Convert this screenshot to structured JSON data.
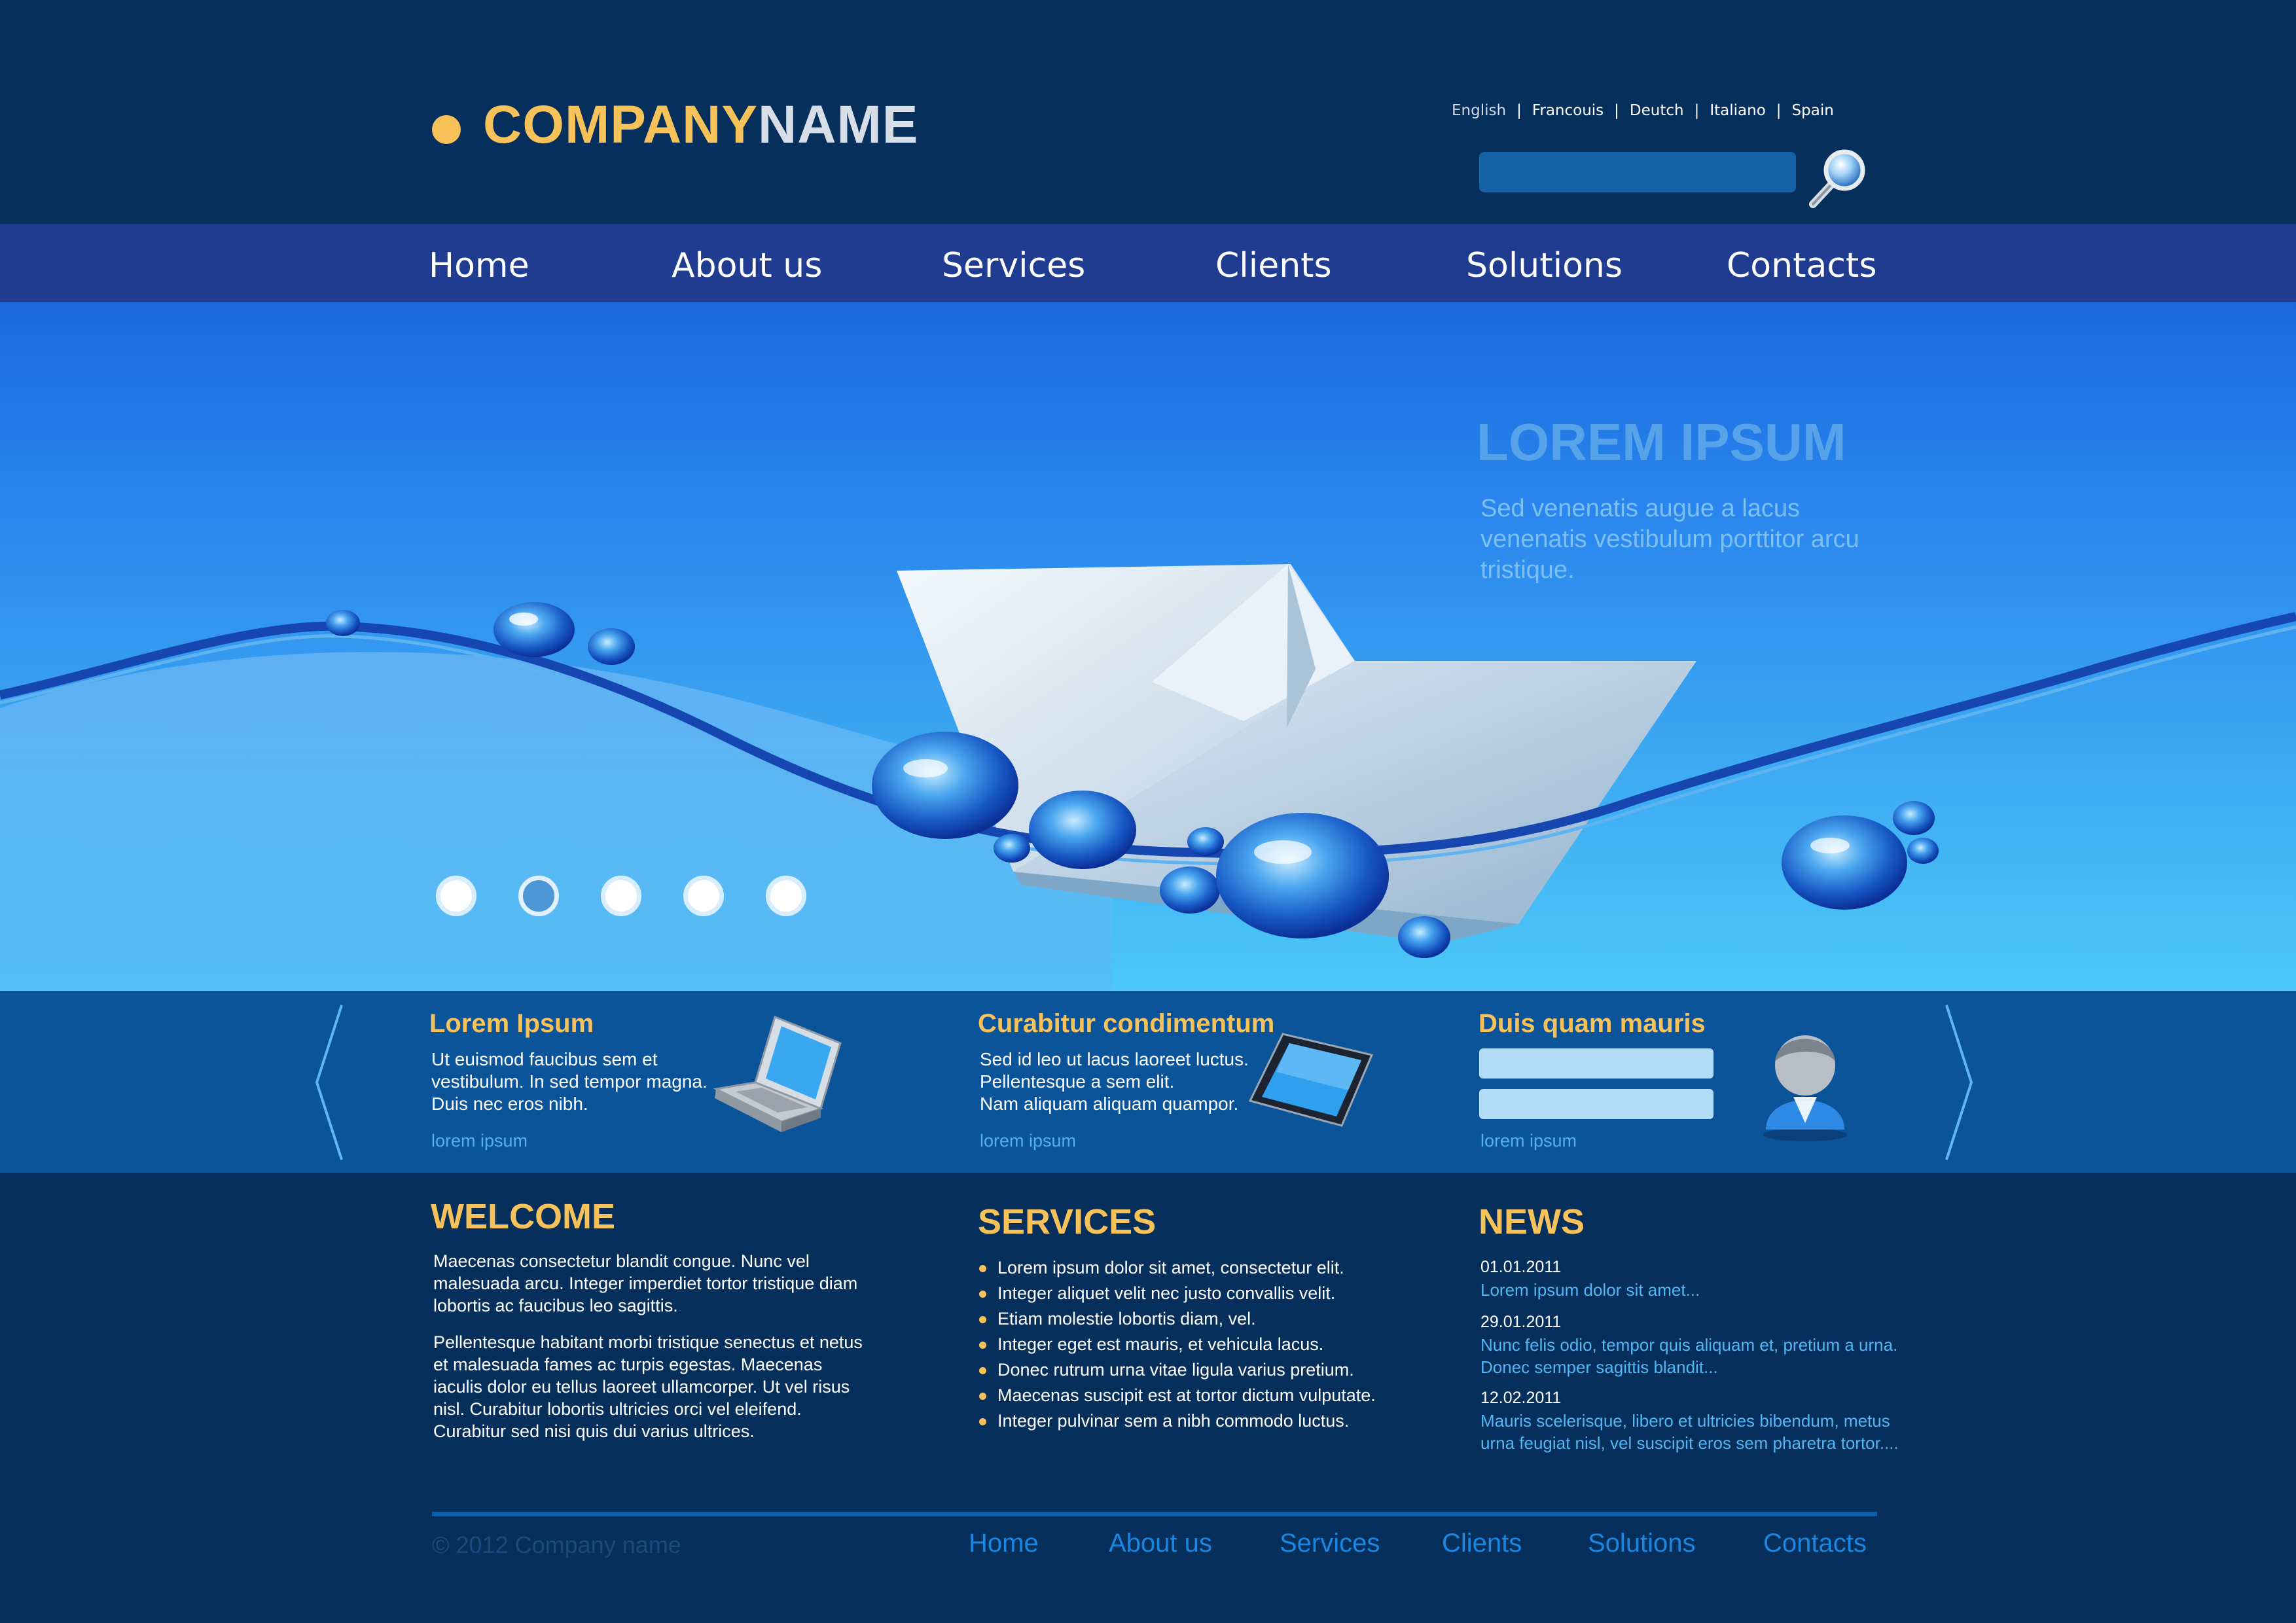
{
  "colors": {
    "background": "#062f5c",
    "nav_bar": "#1f3c91",
    "accent": "#f7c25a",
    "link": "#52b6f3",
    "feature_strip": "#0c5499"
  },
  "header": {
    "logo_part1": "COMPANY",
    "logo_part2": "NAME",
    "languages": [
      "English",
      "Francouis",
      "Deutch",
      "Italiano",
      "Spain"
    ],
    "search_value": "",
    "search_icon": "magnifier-icon"
  },
  "nav": {
    "items": [
      "Home",
      "About us",
      "Services",
      "Clients",
      "Solutions",
      "Contacts"
    ]
  },
  "hero": {
    "title": "LOREM IPSUM",
    "text": "Sed venenatis augue a lacus venenatis vestibulum porttitor arcu tristique.",
    "slides_count": 5,
    "active_slide": 2,
    "image": "paper-boat-on-water-illustration"
  },
  "features": [
    {
      "title": "Lorem Ipsum",
      "lines": [
        "Ut euismod faucibus sem et",
        "vestibulum. In sed tempor magna.",
        "Duis nec eros nibh."
      ],
      "link": "lorem ipsum",
      "icon": "laptop-icon"
    },
    {
      "title": "Curabitur condimentum",
      "lines": [
        "Sed id leo ut lacus laoreet luctus.",
        "Pellentesque a sem elit.",
        "Nam aliquam aliquam quampor."
      ],
      "link": "lorem ipsum",
      "icon": "tablet-icon"
    },
    {
      "title": "Duis quam mauris",
      "inputs": [
        "",
        ""
      ],
      "link": "lorem ipsum",
      "icon": "user-avatar-icon"
    }
  ],
  "welcome": {
    "title": "WELCOME",
    "paragraphs": [
      "Maecenas consectetur blandit congue. Nunc vel malesuada arcu. Integer imperdiet tortor tristique diam lobortis ac faucibus leo sagittis.",
      "Pellentesque habitant morbi tristique senectus et netus et malesuada fames ac turpis egestas. Maecenas iaculis dolor eu tellus laoreet ullamcorper. Ut vel risus nisl. Curabitur lobortis ultricies orci vel eleifend. Curabitur sed nisi quis dui varius ultrices."
    ]
  },
  "services": {
    "title": "SERVICES",
    "items": [
      "Lorem ipsum dolor sit amet, consectetur elit.",
      "Integer aliquet velit nec justo convallis velit.",
      "Etiam molestie lobortis diam,  vel.",
      "Integer eget est mauris, et vehicula lacus.",
      "Donec rutrum urna vitae ligula varius pretium.",
      "Maecenas suscipit est at tortor dictum vulputate.",
      "Integer pulvinar sem a nibh commodo luctus."
    ]
  },
  "news": {
    "title": "NEWS",
    "items": [
      {
        "date": "01.01.2011",
        "text": "Lorem ipsum dolor sit amet..."
      },
      {
        "date": "29.01.2011",
        "text": "Nunc felis odio, tempor quis aliquam et, pretium a urna. Donec semper sagittis blandit..."
      },
      {
        "date": "12.02.2011",
        "text": "Mauris scelerisque, libero et ultricies bibendum, metus urna feugiat nisl, vel suscipit eros sem pharetra tortor...."
      }
    ]
  },
  "footer": {
    "copyright": "© 2012 Company name",
    "nav": [
      "Home",
      "About us",
      "Services",
      "Clients",
      "Solutions",
      "Contacts"
    ]
  }
}
